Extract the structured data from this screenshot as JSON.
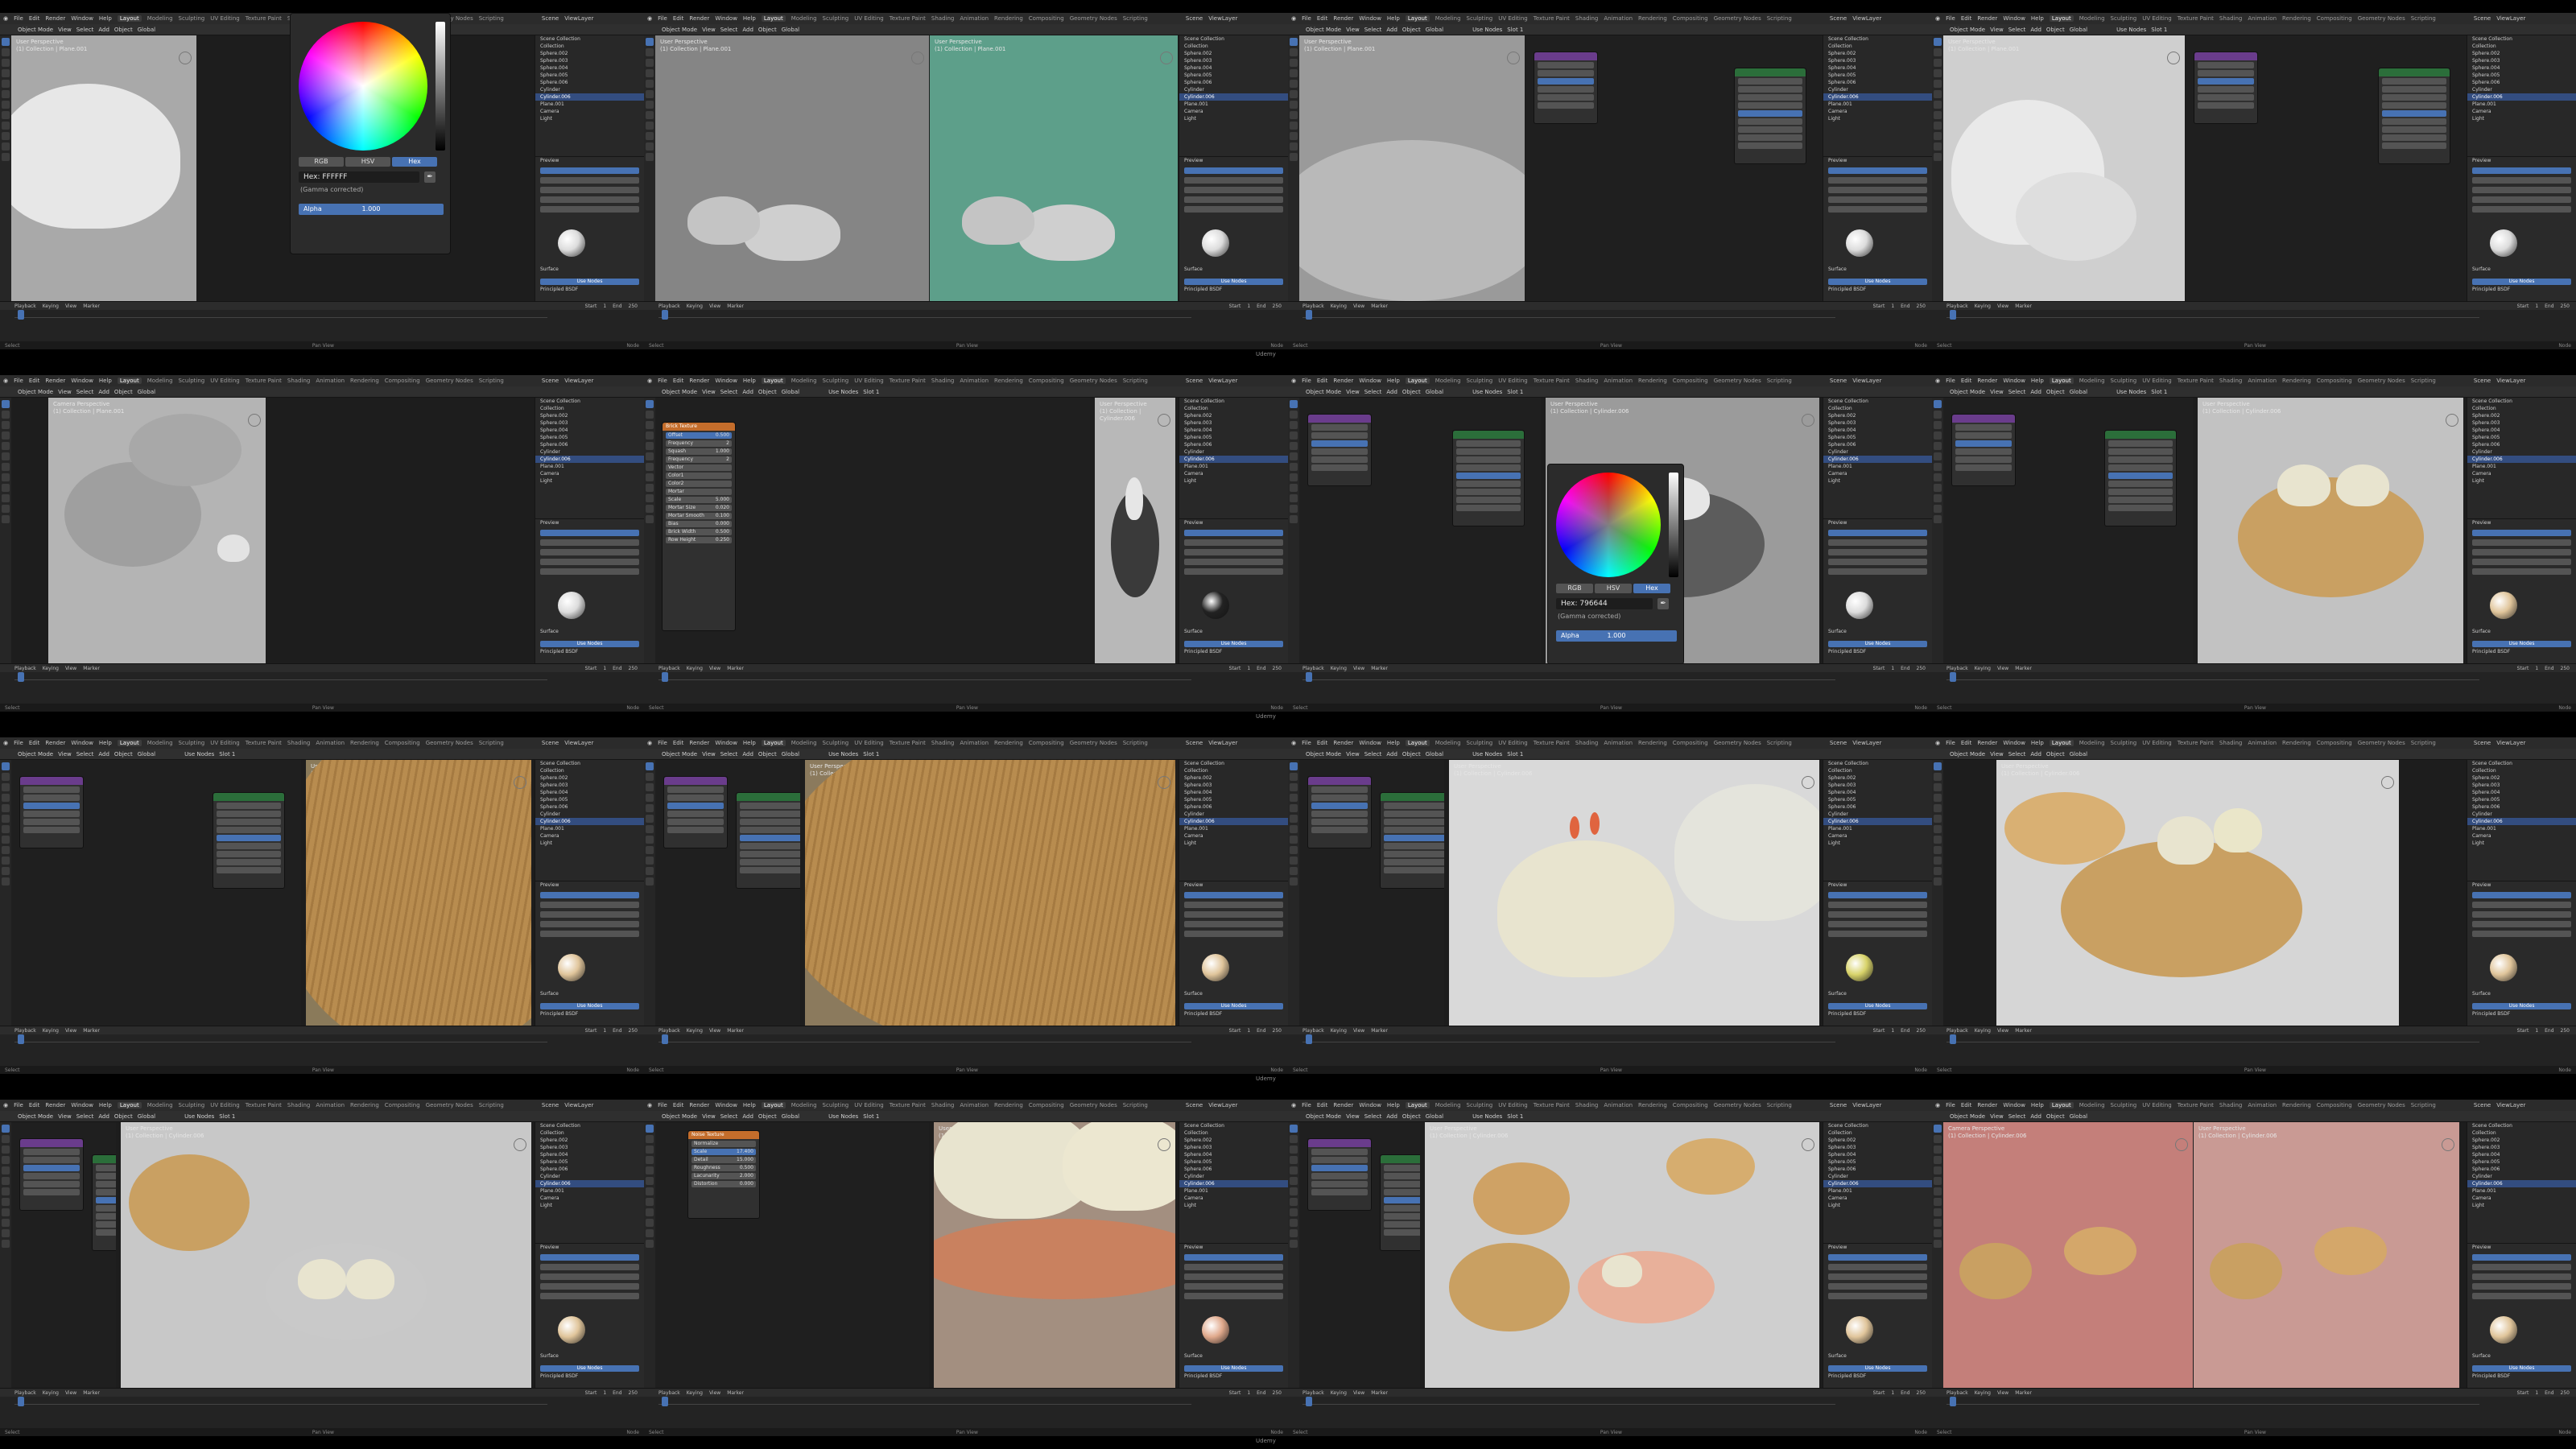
{
  "menu": {
    "items": [
      "File",
      "Edit",
      "Render",
      "Window",
      "Help"
    ],
    "workspaces": [
      "Layout",
      "Modeling",
      "Sculpting",
      "UV Editing",
      "Texture Paint",
      "Shading",
      "Animation",
      "Rendering",
      "Compositing",
      "Geometry Nodes",
      "Scripting"
    ],
    "active_workspace": "Layout",
    "scene": "Scene",
    "view_layer": "ViewLayer"
  },
  "header": {
    "mode": "Object Mode",
    "items": [
      "View",
      "Select",
      "Add",
      "Object"
    ],
    "orientation": "Global",
    "use_nodes": "Use Nodes",
    "slot": "Slot 1"
  },
  "viewport": {
    "user_perspective": "User Perspective",
    "camera_perspective": "Camera Perspective",
    "collection_plane": "(1) Collection | Plane.001",
    "collection_cylinder": "(1) Collection | Cylinder.006"
  },
  "outliner": {
    "items": [
      "Scene Collection",
      "Collection",
      "Sphere.002",
      "Sphere.003",
      "Sphere.004",
      "Sphere.005",
      "Sphere.006",
      "Cylinder",
      "Cylinder.006",
      "Plane.001",
      "Camera",
      "Light"
    ]
  },
  "properties": {
    "preview": "Preview",
    "surface": "Surface",
    "principled": "Principled BSDF",
    "use_nodes": "Use Nodes",
    "settings": "Settings"
  },
  "color_picker_1": {
    "tabs": [
      "RGB",
      "HSV",
      "Hex"
    ],
    "active_tab": "Hex",
    "hex": "Hex: FFFFFF",
    "gamma": "(Gamma corrected)",
    "alpha_label": "Alpha",
    "alpha_value": "1.000"
  },
  "color_picker_2": {
    "tabs": [
      "RGB",
      "HSV",
      "Hex"
    ],
    "active_tab": "Hex",
    "hex": "Hex: 796644",
    "gamma": "(Gamma corrected)",
    "alpha_label": "Alpha",
    "alpha_value": "1.000"
  },
  "brick_node": {
    "title": "Brick Texture",
    "fields": [
      "Offset",
      "Frequency",
      "Squash",
      "Frequency",
      "Vector",
      "Color1",
      "Color2",
      "Mortar",
      "Scale",
      "Mortar Size",
      "Mortar Smooth",
      "Bias",
      "Brick Width",
      "Row Height"
    ],
    "values": [
      "0.500",
      "2",
      "1.000",
      "2",
      "",
      "",
      "",
      "",
      "5.000",
      "0.020",
      "0.100",
      "0.000",
      "0.500",
      "0.250"
    ]
  },
  "noise_node": {
    "title": "Noise Texture",
    "normalize": "Normalize",
    "fields": [
      "Scale",
      "Detail",
      "Roughness",
      "Lacunarity",
      "Distortion"
    ],
    "values": [
      "17.400",
      "15.000",
      "0.500",
      "2.000",
      "0.000"
    ]
  },
  "timeline": {
    "items": [
      "Playback",
      "Keying",
      "View",
      "Marker"
    ],
    "start_label": "Start",
    "start": "1",
    "end_label": "End",
    "end": "250"
  },
  "status": {
    "left": "Select",
    "middle": "Pan View",
    "right": "Node"
  },
  "watermark": "Udemy",
  "colors": {
    "accent": "#4772b3",
    "bun": "#e8e4cf",
    "bamboo": "#c9a062",
    "ear": "#e0643f",
    "teal": "#5d9f8a",
    "pink_bg": "#c47f7a"
  }
}
